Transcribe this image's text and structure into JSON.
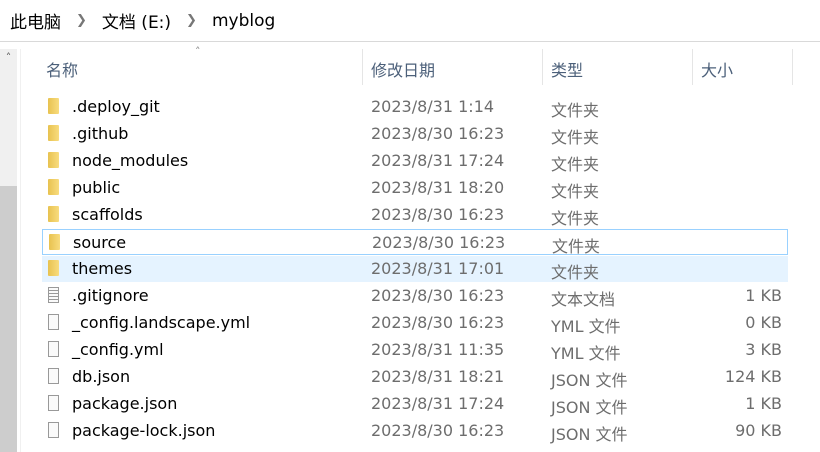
{
  "breadcrumb": [
    "此电脑",
    "文档 (E:)",
    "myblog"
  ],
  "columns": {
    "name": "名称",
    "date": "修改日期",
    "type": "类型",
    "size": "大小"
  },
  "files": [
    {
      "name": ".deploy_git",
      "date": "2023/8/31 1:14",
      "type": "文件夹",
      "size": "",
      "icon": "folder"
    },
    {
      "name": ".github",
      "date": "2023/8/30 16:23",
      "type": "文件夹",
      "size": "",
      "icon": "folder"
    },
    {
      "name": "node_modules",
      "date": "2023/8/31 17:24",
      "type": "文件夹",
      "size": "",
      "icon": "folder"
    },
    {
      "name": "public",
      "date": "2023/8/31 18:20",
      "type": "文件夹",
      "size": "",
      "icon": "folder"
    },
    {
      "name": "scaffolds",
      "date": "2023/8/30 16:23",
      "type": "文件夹",
      "size": "",
      "icon": "folder"
    },
    {
      "name": "source",
      "date": "2023/8/30 16:23",
      "type": "文件夹",
      "size": "",
      "icon": "folder",
      "state": "focused"
    },
    {
      "name": "themes",
      "date": "2023/8/31 17:01",
      "type": "文件夹",
      "size": "",
      "icon": "folder",
      "state": "hover"
    },
    {
      "name": ".gitignore",
      "date": "2023/8/30 16:23",
      "type": "文本文档",
      "size": "1 KB",
      "icon": "text-file"
    },
    {
      "name": "_config.landscape.yml",
      "date": "2023/8/30 16:23",
      "type": "YML 文件",
      "size": "0 KB",
      "icon": "file"
    },
    {
      "name": "_config.yml",
      "date": "2023/8/31 11:35",
      "type": "YML 文件",
      "size": "3 KB",
      "icon": "file"
    },
    {
      "name": "db.json",
      "date": "2023/8/31 18:21",
      "type": "JSON 文件",
      "size": "124 KB",
      "icon": "file"
    },
    {
      "name": "package.json",
      "date": "2023/8/31 17:24",
      "type": "JSON 文件",
      "size": "1 KB",
      "icon": "file"
    },
    {
      "name": "package-lock.json",
      "date": "2023/8/30 16:23",
      "type": "JSON 文件",
      "size": "90 KB",
      "icon": "file"
    }
  ]
}
